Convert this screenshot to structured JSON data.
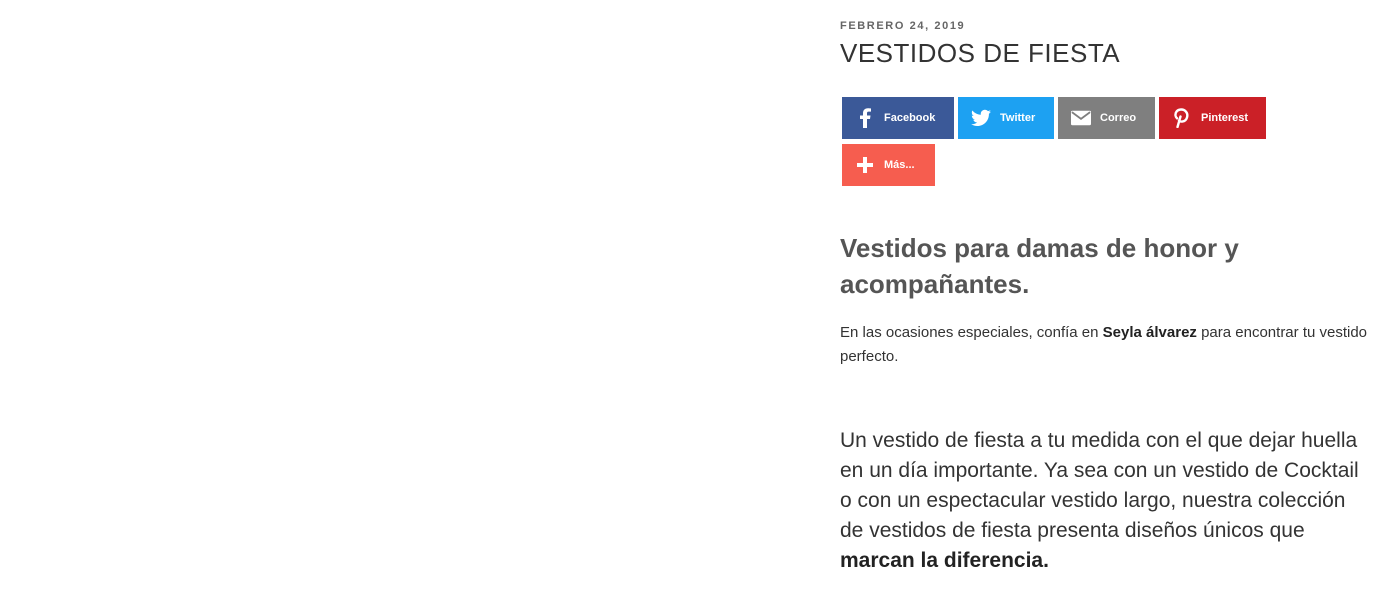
{
  "post": {
    "date": "FEBRERO 24, 2019",
    "title": "VESTIDOS DE FIESTA"
  },
  "share": {
    "facebook": {
      "label": "Facebook",
      "icon": "facebook-icon",
      "color": "#3b5998"
    },
    "twitter": {
      "label": "Twitter",
      "icon": "twitter-icon",
      "color": "#1da1f2"
    },
    "correo": {
      "label": "Correo",
      "icon": "envelope-icon",
      "color": "#7f7f7f"
    },
    "pinterest": {
      "label": "Pinterest",
      "icon": "pinterest-icon",
      "color": "#cb2027"
    },
    "mas": {
      "label": "Más...",
      "icon": "plus-icon",
      "color": "#f65d4f"
    }
  },
  "content": {
    "subheading": "Vestidos para damas de honor y acompañantes.",
    "intro_before": "En las ocasiones especiales, confía en ",
    "intro_strong": "Seyla álvarez",
    "intro_after": " para encontrar tu vestido perfecto.",
    "lead_text": "Un vestido de fiesta a tu medida con el que dejar huella en un día importante. Ya sea con un vestido de Cocktail o con un espectacular vestido largo, nuestra colección de vestidos de fiesta presenta diseños únicos que ",
    "lead_strong": "marcan la diferencia."
  }
}
